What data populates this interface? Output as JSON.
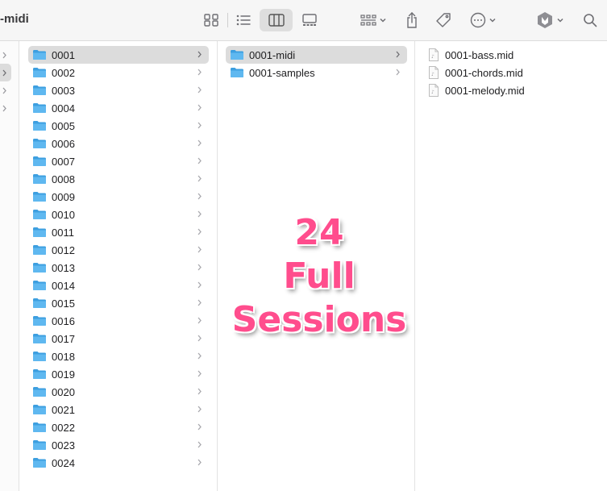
{
  "window": {
    "title": "-midi"
  },
  "toolbar": {
    "icons": [
      "icon-view-icon",
      "list-view-icon",
      "column-view-icon",
      "gallery-view-icon",
      "group-icon",
      "share-icon",
      "tag-icon",
      "more-icon",
      "extension-icon",
      "search-icon"
    ],
    "active_view": "column-view"
  },
  "columns": {
    "folders": [
      "0001",
      "0002",
      "0003",
      "0004",
      "0005",
      "0006",
      "0007",
      "0008",
      "0009",
      "0010",
      "0011",
      "0012",
      "0013",
      "0014",
      "0015",
      "0016",
      "0017",
      "0018",
      "0019",
      "0020",
      "0021",
      "0022",
      "0023",
      "0024"
    ],
    "selected_folder": "0001",
    "subfolders": [
      "0001-midi",
      "0001-samples"
    ],
    "selected_subfolder": "0001-midi",
    "files": [
      "0001-bass.mid",
      "0001-chords.mid",
      "0001-melody.mid"
    ]
  },
  "overlay": {
    "line1": "24",
    "line2": "Full",
    "line3": "Sessions"
  },
  "colors": {
    "folder": "#5fb8f0",
    "folder_dark": "#3d9fe0",
    "selection": "#dcdcdc",
    "overlay_text": "#ff4d8d"
  }
}
